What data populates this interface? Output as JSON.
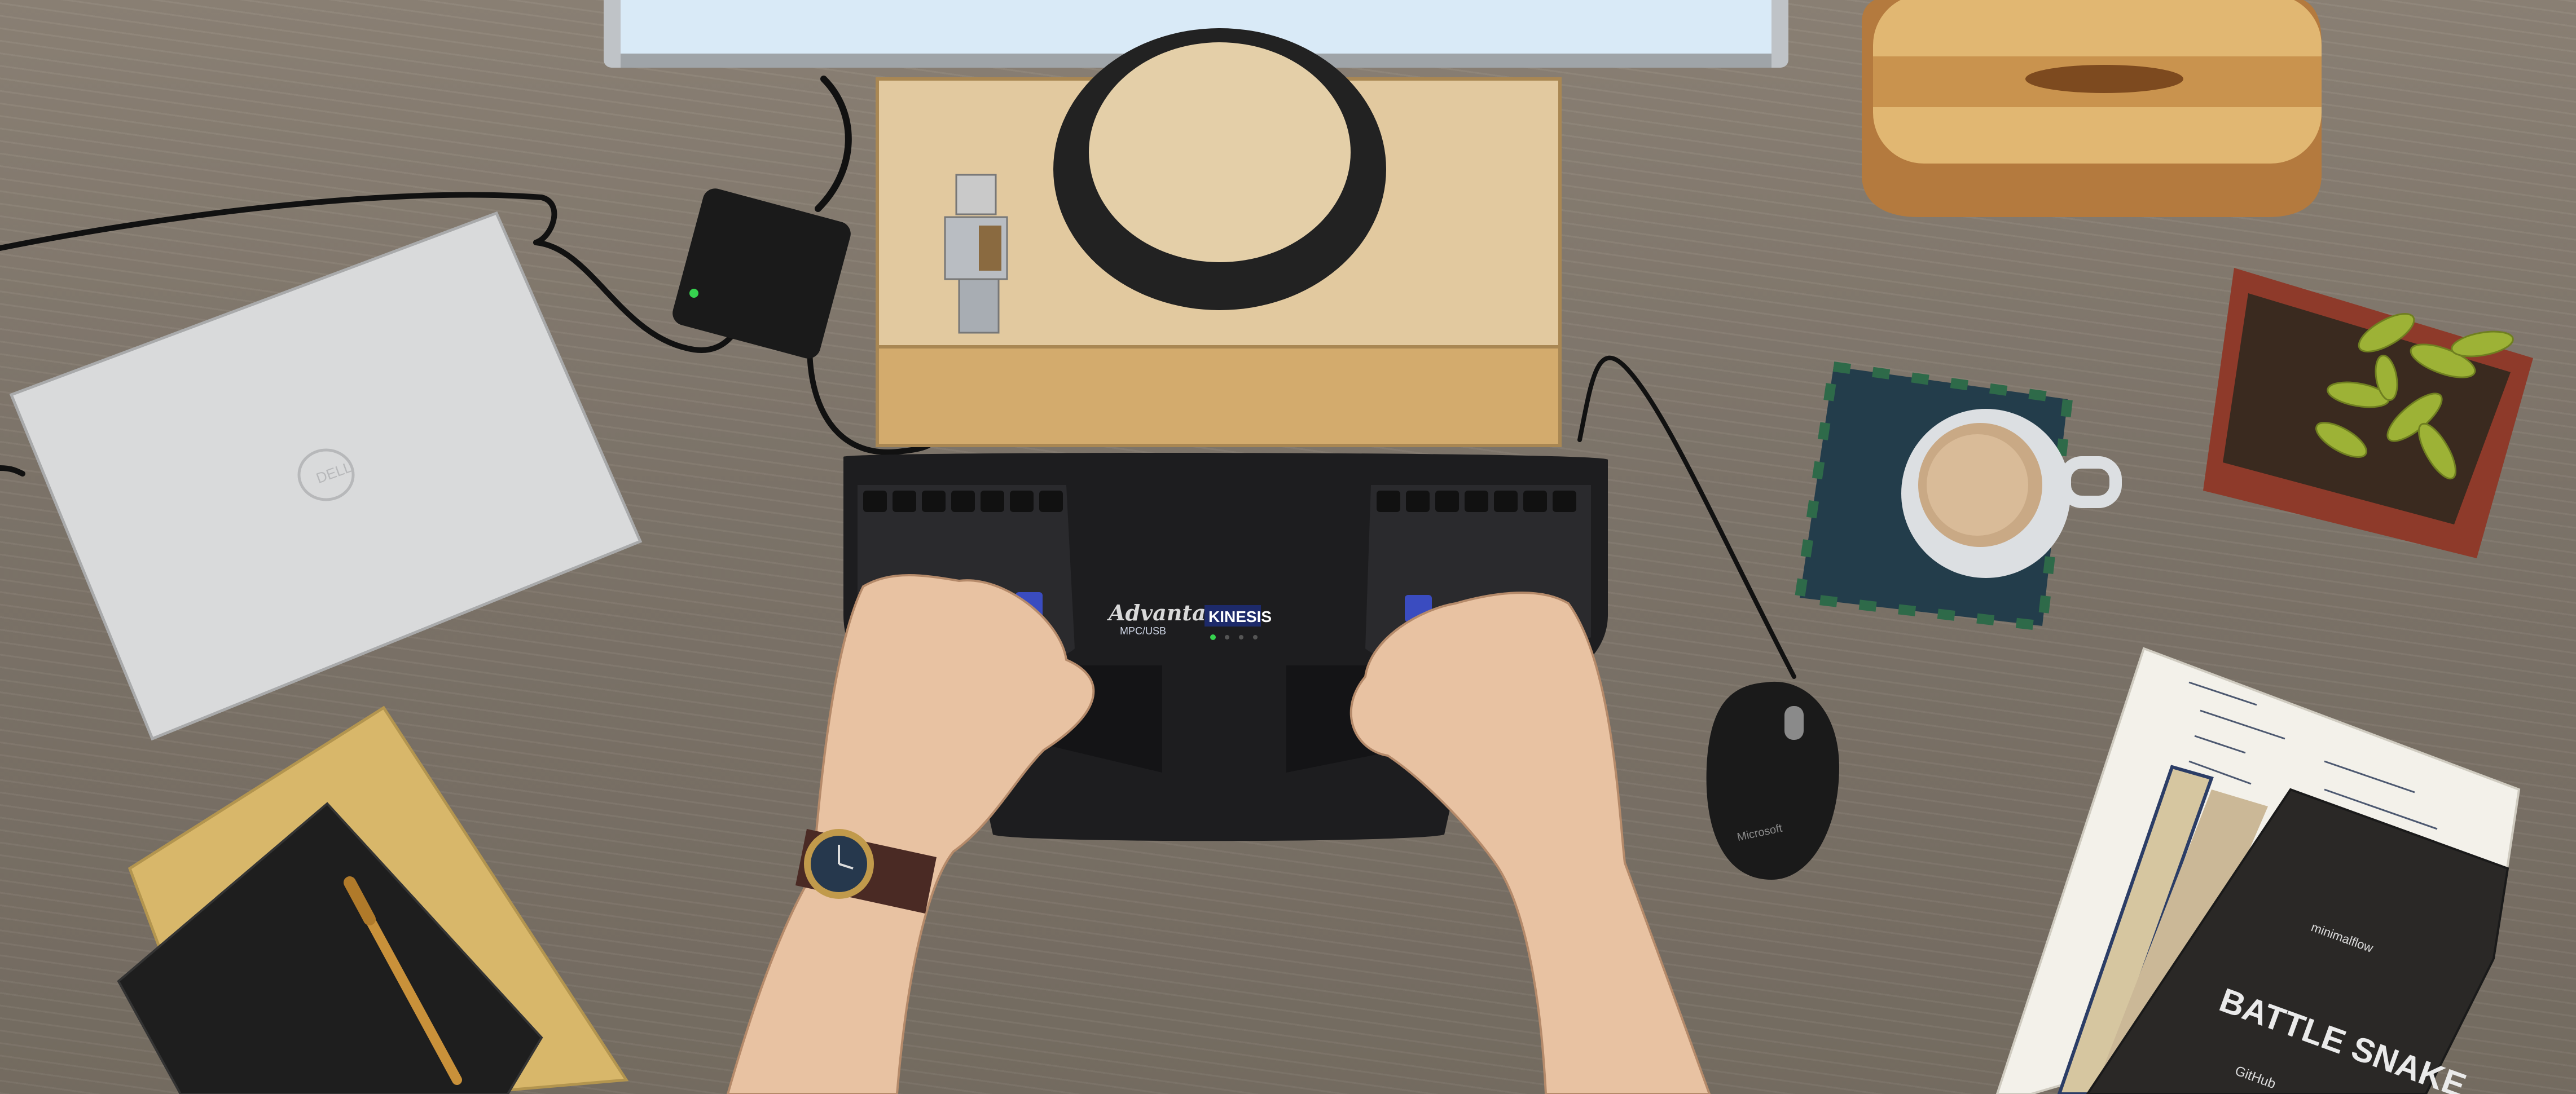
{
  "scene": {
    "caption": "Overhead view of a desk with a Kinesis Advantage split ergonomic keyboard"
  },
  "laptop": {
    "logo": "DELL"
  },
  "keyboard": {
    "model": "Advantage",
    "interface": "MPC/USB",
    "brand": "KINESIS"
  },
  "mouse": {
    "brand": "Microsoft"
  },
  "notebook": {
    "top_label": "minimalflow",
    "title": "BATTLE SNAKE",
    "footer": "GitHub"
  }
}
